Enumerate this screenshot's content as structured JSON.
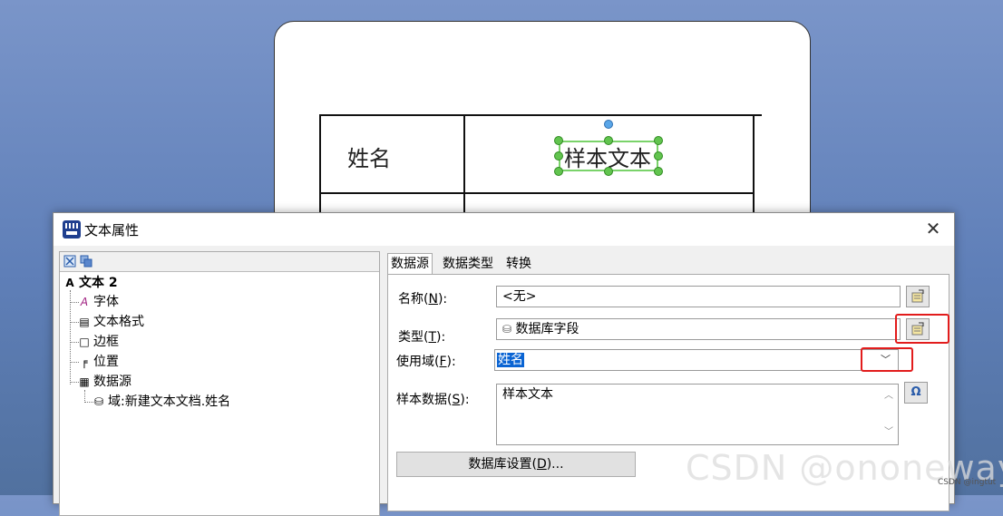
{
  "label_canvas": {
    "cell_name_text": "姓名",
    "cell_value_text": "样本文本"
  },
  "dialog": {
    "title": "文本属性",
    "close_glyph": "✕",
    "tree": {
      "root": "文本 2",
      "items": [
        {
          "label": "字体",
          "icon": "font-icon"
        },
        {
          "label": "文本格式",
          "icon": "text-format-icon"
        },
        {
          "label": "边框",
          "icon": "border-icon"
        },
        {
          "label": "位置",
          "icon": "position-icon"
        },
        {
          "label": "数据源",
          "icon": "datasource-icon"
        }
      ],
      "child": "域:新建文本文档.姓名"
    },
    "tabs": [
      "数据源",
      "数据类型",
      "转换"
    ],
    "form": {
      "name_label": "名称(",
      "name_hotkey": "N",
      "name_label_end": "):",
      "name_value": "<无>",
      "type_label": "类型(",
      "type_hotkey": "T",
      "type_label_end": "):",
      "type_value": "数据库字段",
      "field_label": "使用域(",
      "field_hotkey": "F",
      "field_label_end": "):",
      "field_value": "姓名",
      "sample_label": "样本数据(",
      "sample_hotkey": "S",
      "sample_label_end": "):",
      "sample_value": "样本文本",
      "omega_glyph": "Ω",
      "db_settings_label": "数据库设置(",
      "db_settings_hotkey": "D",
      "db_settings_label_end": ")..."
    }
  },
  "watermark": {
    "text": "CSDN @ononeway",
    "small_text": "CSDN @ingtut"
  },
  "colors": {
    "selection_blue": "#0a64d3",
    "highlight_red": "#e21c1c",
    "handle_green": "#62c44f"
  }
}
